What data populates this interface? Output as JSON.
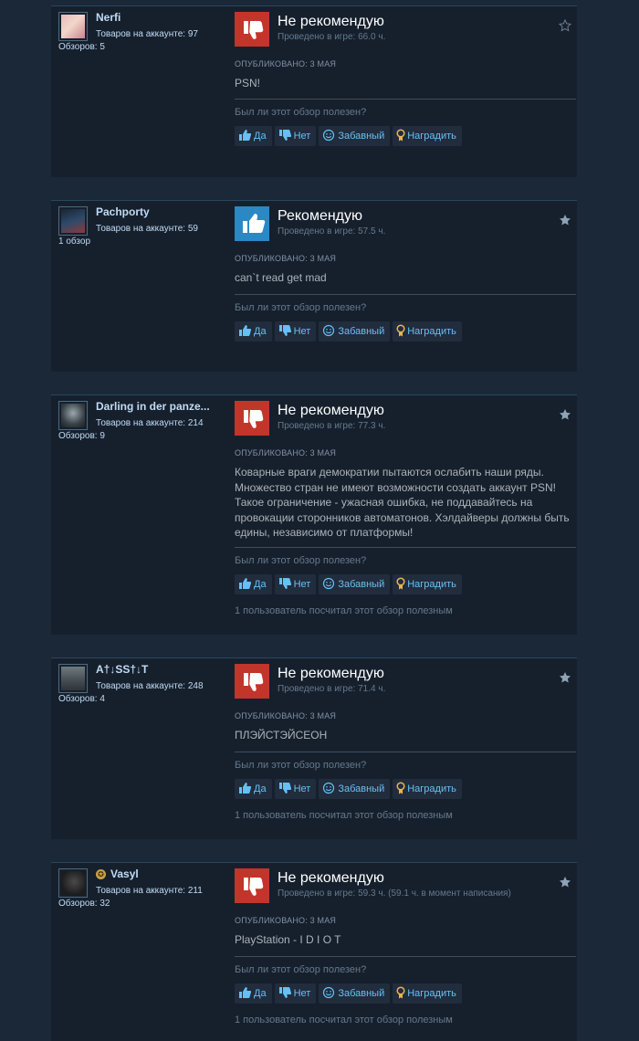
{
  "labels": {
    "helpful_question": "Был ли этот обзор полезен?",
    "yes": "Да",
    "no": "Нет",
    "funny": "Забавный",
    "award": "Наградить"
  },
  "colors": {
    "recommend": "#66c0f4",
    "not_recommend": "#c2352b",
    "link": "#66c0f4"
  },
  "reviews": [
    {
      "persona": "Nerfi",
      "owned": "Товаров на аккаунте: 97",
      "reviews_count": "Обзоров: 5",
      "verdict": "Не рекомендую",
      "recommended": false,
      "hours": "Проведено в игре: 66.0 ч.",
      "posted": "ОПУБЛИКОВАНО: 3 МАЯ",
      "text": "PSN!",
      "helpful": ""
    },
    {
      "persona": "Pachporty",
      "owned": "Товаров на аккаунте: 59",
      "reviews_count": "1 обзор",
      "verdict": "Рекомендую",
      "recommended": true,
      "hours": "Проведено в игре: 57.5 ч.",
      "posted": "ОПУБЛИКОВАНО: 3 МАЯ",
      "text": "can`t read get mad",
      "helpful": ""
    },
    {
      "persona": "Darling in der panze...",
      "owned": "Товаров на аккаунте: 214",
      "reviews_count": "Обзоров: 9",
      "verdict": "Не рекомендую",
      "recommended": false,
      "hours": "Проведено в игре: 77.3 ч.",
      "posted": "ОПУБЛИКОВАНО: 3 МАЯ",
      "text": "Коварные враги демократии пытаются ослабить наши ряды. Множество стран не имеют возможности создать аккаунт PSN! Такое ограничение - ужасная ошибка, не поддавайтесь на провокации сторонников автоматонов. Хэлдайверы должны быть едины, независимо от платформы!",
      "helpful": "1 пользователь посчитал этот обзор полезным"
    },
    {
      "persona": "A†↓SS†↓T",
      "owned": "Товаров на аккаунте: 248",
      "reviews_count": "Обзоров: 4",
      "verdict": "Не рекомендую",
      "recommended": false,
      "hours": "Проведено в игре: 71.4 ч.",
      "posted": "ОПУБЛИКОВАНО: 3 МАЯ",
      "text": "ПЛЭЙСТЭЙСЕОН",
      "helpful": "1 пользователь посчитал этот обзор полезным"
    },
    {
      "persona": "Vasyl",
      "owned": "Товаров на аккаунте: 211",
      "reviews_count": "Обзоров: 32",
      "verdict": "Не рекомендую",
      "recommended": false,
      "hours": "Проведено в игре: 59.3 ч. (59.1 ч. в момент написания)",
      "posted": "ОПУБЛИКОВАНО: 3 МАЯ",
      "text": "PlayStation - I D I O T",
      "helpful": "1 пользователь посчитал этот обзор полезным"
    }
  ]
}
